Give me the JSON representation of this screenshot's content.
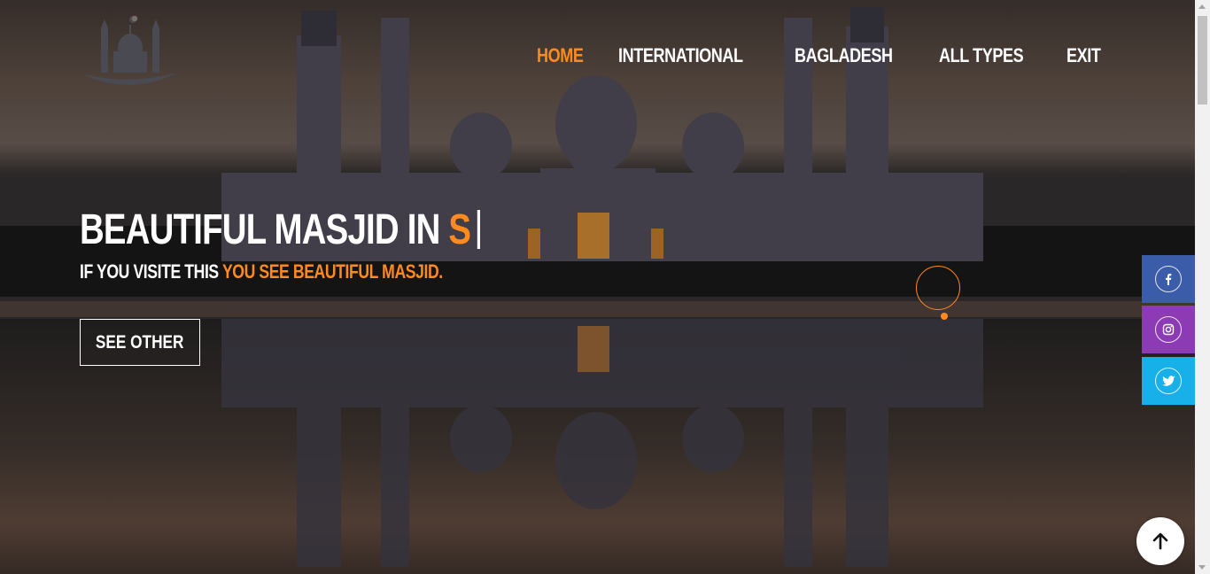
{
  "nav": {
    "items": [
      {
        "label": "HOME",
        "active": true
      },
      {
        "label": "INTERNATIONAL",
        "active": false
      },
      {
        "label": "BAGLADESH",
        "active": false
      },
      {
        "label": "ALL TYPES",
        "active": false
      },
      {
        "label": "EXIT",
        "active": false
      }
    ]
  },
  "hero": {
    "headline_main": "BEAUTIFUL MASJID IN ",
    "headline_typed": "S",
    "sub_main": "IF YOU VISITE THIS ",
    "sub_accent": "YOU SEE BEAUTIFUL MASJID.",
    "cta_label": "SEE OTHER"
  },
  "social": {
    "facebook_icon": "facebook-icon",
    "instagram_icon": "instagram-icon",
    "twitter_icon": "twitter-icon"
  },
  "back_to_top_icon": "arrow-up-icon",
  "colors": {
    "accent": "#ff8a1d",
    "facebook": "#3b5ca8",
    "instagram": "#8d3bb5",
    "twitter": "#17b0e8"
  }
}
